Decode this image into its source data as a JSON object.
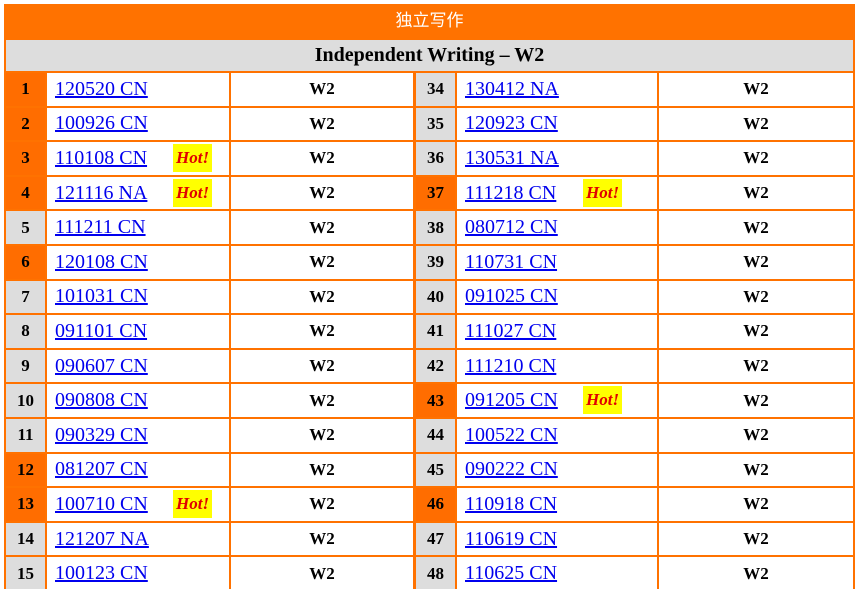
{
  "header": {
    "title": "独立写作",
    "subtitle": "Independent Writing – W2"
  },
  "hot_label": "Hot!",
  "colors": {
    "accent": "#ff7200",
    "number_orange": "#ff6d00",
    "number_gray": "#dddddd",
    "link": "#0000ee",
    "hot_bg": "#ffff00",
    "hot_text": "#e00000"
  },
  "rows": [
    {
      "left": {
        "num": "1",
        "label": "120520 CN",
        "type": "W2",
        "hot": false,
        "highlight": true
      },
      "right": {
        "num": "34",
        "label": "130412 NA",
        "type": "W2",
        "hot": false,
        "highlight": false
      }
    },
    {
      "left": {
        "num": "2",
        "label": "100926 CN",
        "type": "W2",
        "hot": false,
        "highlight": true
      },
      "right": {
        "num": "35",
        "label": "120923 CN",
        "type": "W2",
        "hot": false,
        "highlight": false
      }
    },
    {
      "left": {
        "num": "3",
        "label": "110108 CN",
        "type": "W2",
        "hot": true,
        "highlight": true
      },
      "right": {
        "num": "36",
        "label": "130531 NA",
        "type": "W2",
        "hot": false,
        "highlight": false
      }
    },
    {
      "left": {
        "num": "4",
        "label": "121116 NA",
        "type": "W2",
        "hot": true,
        "highlight": true
      },
      "right": {
        "num": "37",
        "label": "111218 CN",
        "type": "W2",
        "hot": true,
        "highlight": true
      }
    },
    {
      "left": {
        "num": "5",
        "label": "111211 CN",
        "type": "W2",
        "hot": false,
        "highlight": false
      },
      "right": {
        "num": "38",
        "label": "080712 CN",
        "type": "W2",
        "hot": false,
        "highlight": false
      }
    },
    {
      "left": {
        "num": "6",
        "label": "120108 CN",
        "type": "W2",
        "hot": false,
        "highlight": true
      },
      "right": {
        "num": "39",
        "label": "110731 CN",
        "type": "W2",
        "hot": false,
        "highlight": false
      }
    },
    {
      "left": {
        "num": "7",
        "label": "101031 CN",
        "type": "W2",
        "hot": false,
        "highlight": false
      },
      "right": {
        "num": "40",
        "label": "091025 CN",
        "type": "W2",
        "hot": false,
        "highlight": false
      }
    },
    {
      "left": {
        "num": "8",
        "label": "091101 CN",
        "type": "W2",
        "hot": false,
        "highlight": false
      },
      "right": {
        "num": "41",
        "label": "111027 CN",
        "type": "W2",
        "hot": false,
        "highlight": false
      }
    },
    {
      "left": {
        "num": "9",
        "label": "090607 CN",
        "type": "W2",
        "hot": false,
        "highlight": false
      },
      "right": {
        "num": "42",
        "label": "111210 CN",
        "type": "W2",
        "hot": false,
        "highlight": false
      }
    },
    {
      "left": {
        "num": "10",
        "label": "090808 CN",
        "type": "W2",
        "hot": false,
        "highlight": false
      },
      "right": {
        "num": "43",
        "label": "091205 CN",
        "type": "W2",
        "hot": true,
        "highlight": true
      }
    },
    {
      "left": {
        "num": "11",
        "label": "090329 CN",
        "type": "W2",
        "hot": false,
        "highlight": false
      },
      "right": {
        "num": "44",
        "label": "100522 CN",
        "type": "W2",
        "hot": false,
        "highlight": false
      }
    },
    {
      "left": {
        "num": "12",
        "label": "081207 CN",
        "type": "W2",
        "hot": false,
        "highlight": true
      },
      "right": {
        "num": "45",
        "label": "090222 CN",
        "type": "W2",
        "hot": false,
        "highlight": false
      }
    },
    {
      "left": {
        "num": "13",
        "label": "100710 CN",
        "type": "W2",
        "hot": true,
        "highlight": true
      },
      "right": {
        "num": "46",
        "label": "110918 CN",
        "type": "W2",
        "hot": false,
        "highlight": true
      }
    },
    {
      "left": {
        "num": "14",
        "label": "121207 NA",
        "type": "W2",
        "hot": false,
        "highlight": false
      },
      "right": {
        "num": "47",
        "label": "110619 CN",
        "type": "W2",
        "hot": false,
        "highlight": false
      }
    },
    {
      "left": {
        "num": "15",
        "label": "100123 CN",
        "type": "W2",
        "hot": false,
        "highlight": false
      },
      "right": {
        "num": "48",
        "label": "110625 CN",
        "type": "W2",
        "hot": false,
        "highlight": false
      }
    }
  ]
}
